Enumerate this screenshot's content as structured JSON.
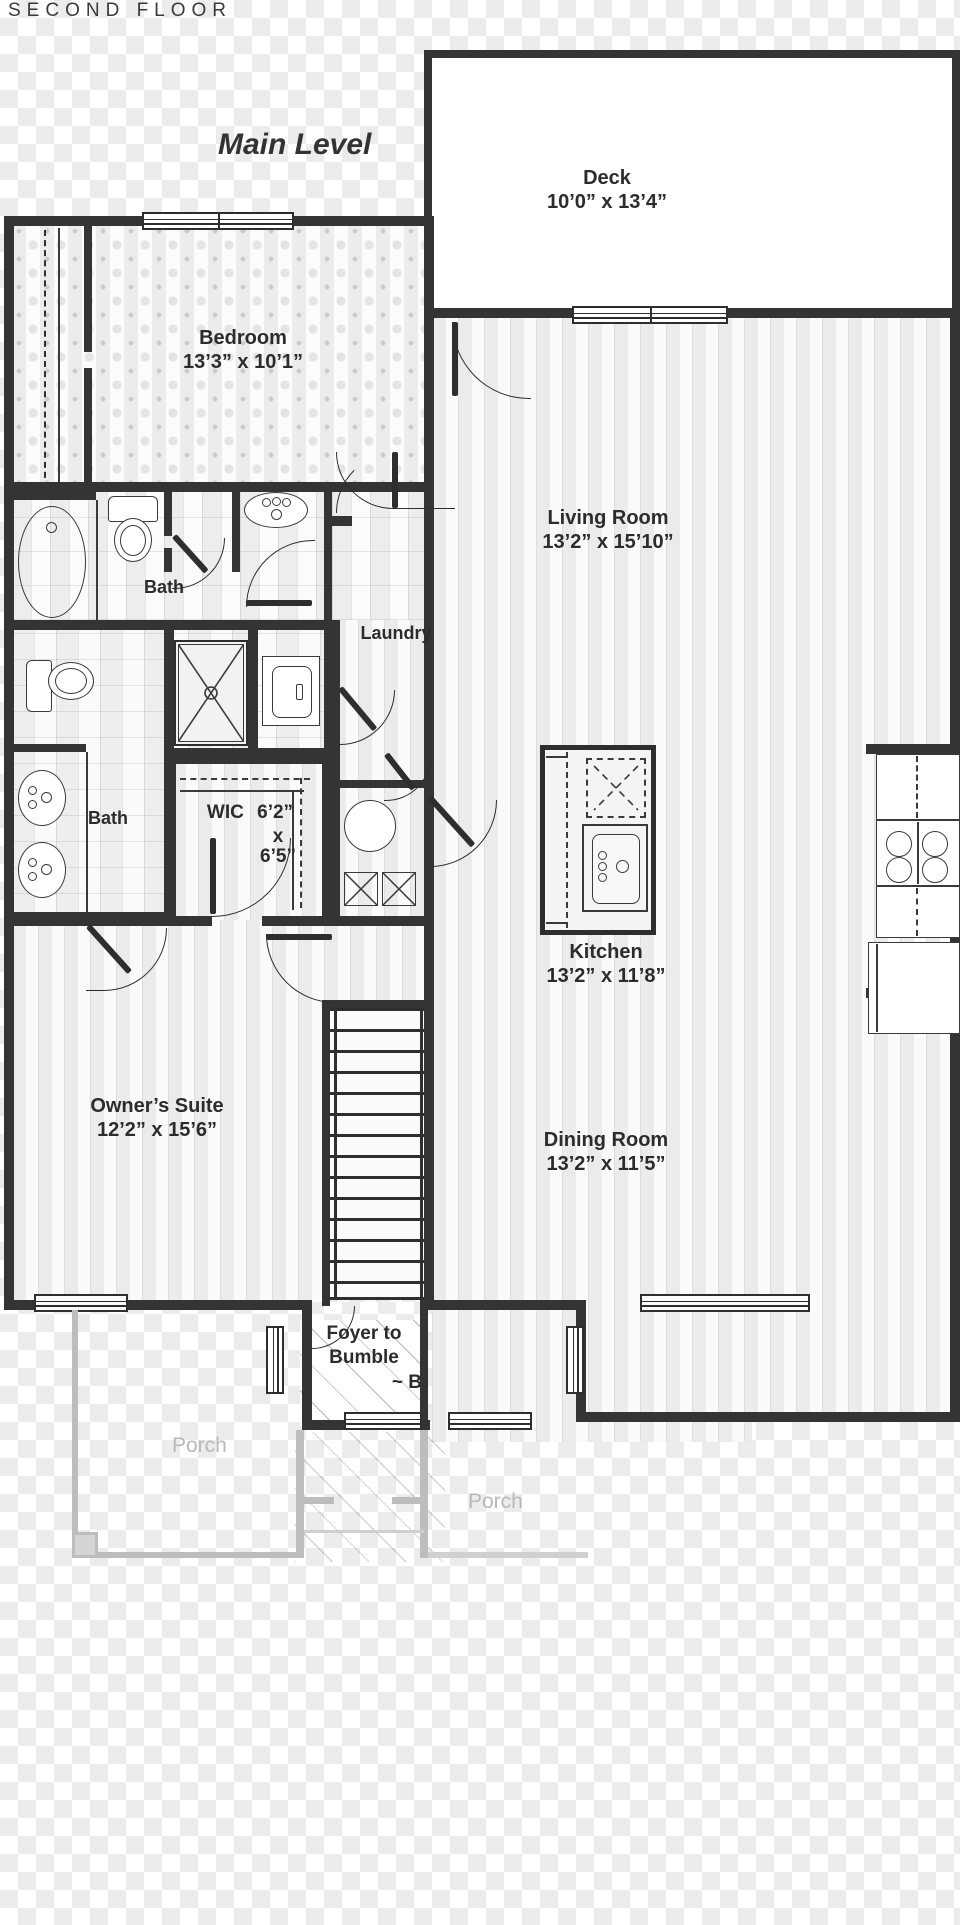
{
  "header": {
    "title": "SECOND FLOOR"
  },
  "plan": {
    "level_title": "Main Level",
    "rooms": [
      {
        "key": "deck",
        "name": "Deck",
        "dimensions": "10’0” x 13’4”"
      },
      {
        "key": "bedroom",
        "name": "Bedroom",
        "dimensions": "13’3” x 10’1”"
      },
      {
        "key": "living",
        "name": "Living Room",
        "dimensions": "13’2” x 15’10”"
      },
      {
        "key": "kitchen",
        "name": "Kitchen",
        "dimensions": "13’2” x 11’8”"
      },
      {
        "key": "dining",
        "name": "Dining Room",
        "dimensions": "13’2” x 11’5”"
      },
      {
        "key": "owners",
        "name": "Owner’s Suite",
        "dimensions": "12’2” x 15’6”"
      }
    ],
    "bath_upper_label": "Bath",
    "bath_lower_label": "Bath",
    "laundry_label": "Laundry",
    "wic": {
      "name": "WIC",
      "dim_line1": "6’2”",
      "dim_line2": "x",
      "dim_line3": "6’5”"
    },
    "foyer": {
      "line1": "Foyer to",
      "line2": "Bumble",
      "line3": "~ B"
    },
    "porch_left_label": "Porch",
    "porch_right_label": "Porch"
  },
  "colors": {
    "wall": "#343434",
    "text": "#2c2c2c",
    "muted": "#b8b8b8",
    "background": "#ffffff"
  }
}
